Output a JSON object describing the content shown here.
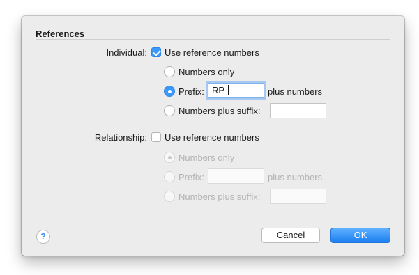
{
  "references": {
    "title": "References",
    "individual": {
      "label": "Individual:",
      "checkbox_label": "Use reference numbers",
      "checked": true,
      "options": {
        "numbers_only": "Numbers only",
        "prefix": "Prefix:",
        "prefix_value": "RP-",
        "prefix_suffix_text": "plus numbers",
        "numbers_plus_suffix": "Numbers plus suffix:",
        "suffix_value": ""
      },
      "selected_option": "prefix"
    },
    "relationship": {
      "label": "Relationship:",
      "checkbox_label": "Use reference numbers",
      "checked": false,
      "options": {
        "numbers_only": "Numbers only",
        "prefix": "Prefix:",
        "prefix_value": "",
        "prefix_suffix_text": "plus numbers",
        "numbers_plus_suffix": "Numbers plus suffix:",
        "suffix_value": ""
      },
      "selected_option": "numbers_only"
    }
  },
  "footer": {
    "help_label": "?",
    "cancel_label": "Cancel",
    "ok_label": "OK"
  },
  "colors": {
    "accent": "#3b99fc",
    "dialog_background": "#ececec",
    "disabled_text": "#b3b3b3"
  }
}
